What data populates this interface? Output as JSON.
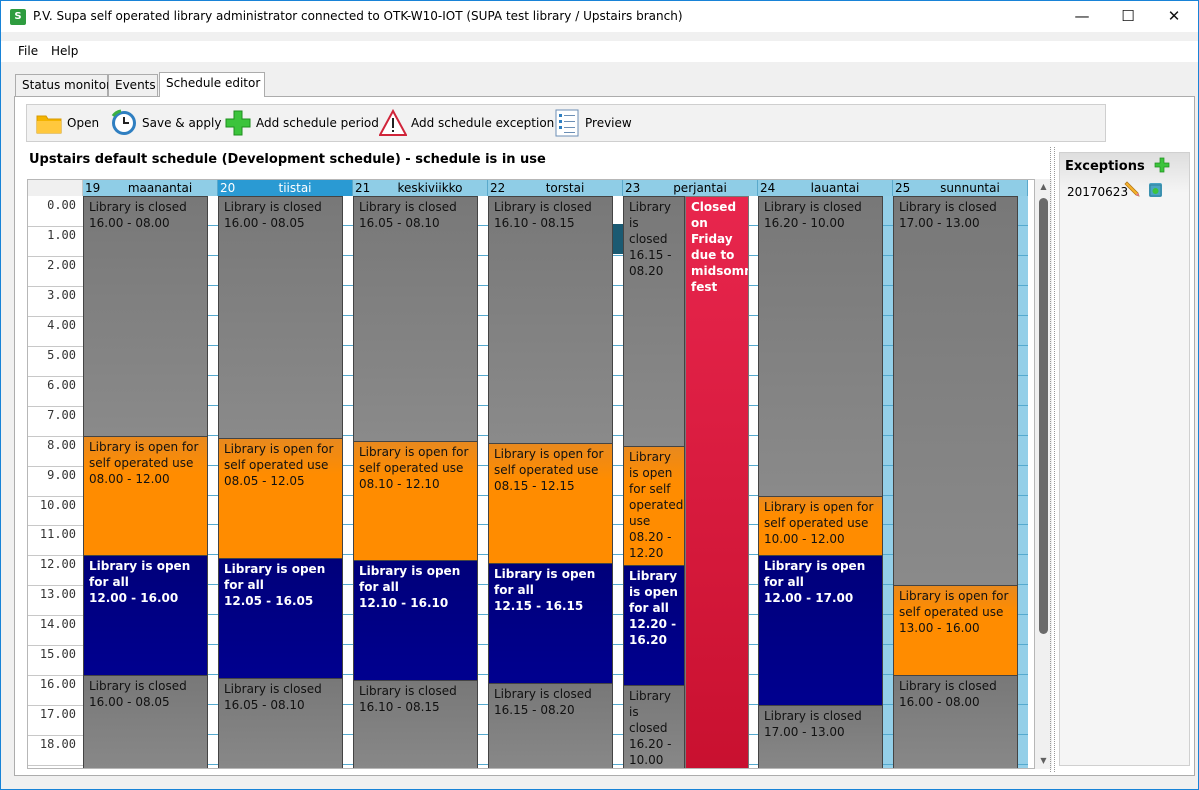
{
  "window": {
    "title": "P.V. Supa self operated library administrator connected to OTK-W10-IOT (SUPA test library / Upstairs branch)",
    "app_icon": "supa-app-icon",
    "controls": {
      "minimize": "—",
      "maximize": "☐",
      "close": "✕"
    }
  },
  "menu": [
    {
      "label": "File"
    },
    {
      "label": "Help"
    }
  ],
  "tabs": [
    {
      "label": "Status monitor",
      "active": false
    },
    {
      "label": "Events",
      "active": false
    },
    {
      "label": "Schedule editor",
      "active": true
    }
  ],
  "toolbar": [
    {
      "label": "Open",
      "icon": "folder-icon"
    },
    {
      "label": "Save & apply",
      "icon": "clock-save-icon"
    },
    {
      "label": "Add schedule period",
      "icon": "green-plus-icon"
    },
    {
      "label": "Add schedule exception",
      "icon": "warning-icon"
    },
    {
      "label": "Preview",
      "icon": "list-icon"
    }
  ],
  "schedule_title": "Upstairs default schedule (Development schedule) - schedule is in use",
  "hours": [
    "0.00",
    "1.00",
    "2.00",
    "3.00",
    "4.00",
    "5.00",
    "6.00",
    "7.00",
    "8.00",
    "9.00",
    "10.00",
    "11.00",
    "12.00",
    "13.00",
    "14.00",
    "15.00",
    "16.00",
    "17.00",
    "18.00"
  ],
  "colors": {
    "closed": "#808080",
    "self_operated": "#ff8c00",
    "open_for_all": "#000088",
    "exception": "#dc143c",
    "header": "#8fcde6",
    "header_selected": "#2a9ad3"
  },
  "days": [
    {
      "num": "19",
      "name": "maanantai",
      "selected": false,
      "weekend": false,
      "blocks": [
        {
          "type": "closed",
          "title": "Library is closed",
          "time": "16.00 - 08.00",
          "start": 0,
          "end": 8.0
        },
        {
          "type": "self",
          "title": "Library is open for self operated use",
          "time": "08.00 - 12.00",
          "start": 8.0,
          "end": 12.0
        },
        {
          "type": "open",
          "title": "Library is open for all",
          "time": "12.00 - 16.00",
          "start": 12.0,
          "end": 16.0
        },
        {
          "type": "closed",
          "title": "Library is closed",
          "time": "16.00 - 08.05",
          "start": 16.0,
          "end": 19.5
        }
      ]
    },
    {
      "num": "20",
      "name": "tiistai",
      "selected": true,
      "weekend": false,
      "blocks": [
        {
          "type": "closed",
          "title": "Library is closed",
          "time": "16.00 - 08.05",
          "start": 0,
          "end": 8.0833
        },
        {
          "type": "self",
          "title": "Library is open for self operated use",
          "time": "08.05 - 12.05",
          "start": 8.0833,
          "end": 12.0833
        },
        {
          "type": "open",
          "title": "Library is open for all",
          "time": "12.05 - 16.05",
          "start": 12.0833,
          "end": 16.0833
        },
        {
          "type": "closed",
          "title": "Library is closed",
          "time": "16.05 - 08.10",
          "start": 16.0833,
          "end": 19.5
        }
      ]
    },
    {
      "num": "21",
      "name": "keskiviikko",
      "selected": false,
      "weekend": false,
      "blocks": [
        {
          "type": "closed",
          "title": "Library is closed",
          "time": "16.05 - 08.10",
          "start": 0,
          "end": 8.1667
        },
        {
          "type": "self",
          "title": "Library is open for self operated use",
          "time": "08.10 - 12.10",
          "start": 8.1667,
          "end": 12.1667
        },
        {
          "type": "open",
          "title": "Library is open for all",
          "time": "12.10 - 16.10",
          "start": 12.1667,
          "end": 16.1667
        },
        {
          "type": "closed",
          "title": "Library is closed",
          "time": "16.10 - 08.15",
          "start": 16.1667,
          "end": 19.5
        }
      ]
    },
    {
      "num": "22",
      "name": "torstai",
      "selected": false,
      "weekend": false,
      "blocks": [
        {
          "type": "closed",
          "title": "Library is closed",
          "time": "16.10 - 08.15",
          "start": 0,
          "end": 8.25
        },
        {
          "type": "self",
          "title": "Library is open for self operated use",
          "time": "08.15 - 12.15",
          "start": 8.25,
          "end": 12.25
        },
        {
          "type": "open",
          "title": "Library is open for all",
          "time": "12.15 - 16.15",
          "start": 12.25,
          "end": 16.25
        },
        {
          "type": "closed",
          "title": "Library is closed",
          "time": "16.15 - 08.20",
          "start": 16.25,
          "end": 19.5
        }
      ]
    },
    {
      "num": "23",
      "name": "perjantai",
      "selected": false,
      "weekend": false,
      "split": true,
      "blocks": [
        {
          "type": "closed",
          "title": "Library is closed",
          "time": "16.15 - 08.20",
          "start": 0,
          "end": 8.3333
        },
        {
          "type": "self",
          "title": "Library is open for self operated use",
          "time": "08.20 - 12.20",
          "start": 8.3333,
          "end": 12.3333
        },
        {
          "type": "open",
          "title": "Library is open for all",
          "time": "12.20 - 16.20",
          "start": 12.3333,
          "end": 16.3333
        },
        {
          "type": "closed",
          "title": "Library is closed",
          "time": "16.20 - 10.00",
          "start": 16.3333,
          "end": 19.5
        }
      ],
      "exception": {
        "type": "exception",
        "title": "Closed on Friday due to midsommer fest",
        "time": "",
        "start": 0,
        "end": 19.5
      }
    },
    {
      "num": "24",
      "name": "lauantai",
      "selected": false,
      "weekend": true,
      "blocks": [
        {
          "type": "closed",
          "title": "Library is closed",
          "time": "16.20 - 10.00",
          "start": 0,
          "end": 10.0
        },
        {
          "type": "self",
          "title": "Library is open for self operated use",
          "time": "10.00 - 12.00",
          "start": 10.0,
          "end": 12.0
        },
        {
          "type": "open",
          "title": "Library is open for all",
          "time": "12.00 - 17.00",
          "start": 12.0,
          "end": 17.0
        },
        {
          "type": "closed",
          "title": "Library is closed",
          "time": "17.00 - 13.00",
          "start": 17.0,
          "end": 19.5
        }
      ]
    },
    {
      "num": "25",
      "name": "sunnuntai",
      "selected": false,
      "weekend": true,
      "blocks": [
        {
          "type": "closed",
          "title": "Library is closed",
          "time": "17.00 - 13.00",
          "start": 0,
          "end": 13.0
        },
        {
          "type": "self",
          "title": "Library is open for self operated use",
          "time": "13.00 - 16.00",
          "start": 13.0,
          "end": 16.0
        },
        {
          "type": "closed",
          "title": "Library is closed",
          "time": "16.00 - 08.00",
          "start": 16.0,
          "end": 19.5
        }
      ]
    }
  ],
  "exceptions": {
    "title": "Exceptions",
    "items": [
      {
        "label": "20170623"
      }
    ]
  },
  "scrollbar": {
    "up": "▲",
    "down": "▼"
  }
}
